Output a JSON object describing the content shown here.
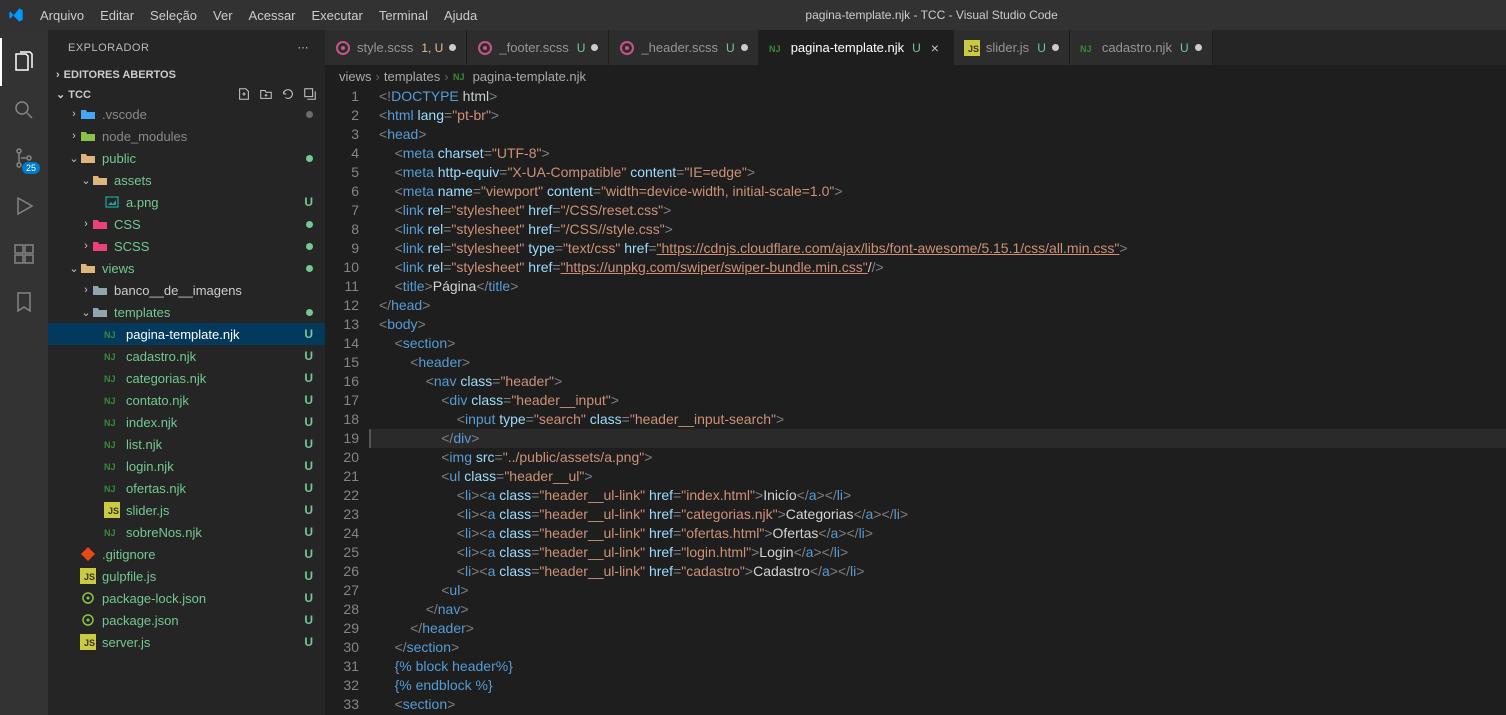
{
  "window": {
    "title": "pagina-template.njk - TCC - Visual Studio Code"
  },
  "menu": [
    "Arquivo",
    "Editar",
    "Seleção",
    "Ver",
    "Acessar",
    "Executar",
    "Terminal",
    "Ajuda"
  ],
  "activitybar": {
    "scm_badge": "25"
  },
  "sidebar": {
    "title": "EXPLORADOR",
    "section_open_editors": "EDITORES ABERTOS",
    "root": "TCC",
    "tree": [
      {
        "indent": 1,
        "chev": "›",
        "icon": "folder-blue",
        "label": ".vscode",
        "color": "#8a8a8a",
        "dot": "#6c6c6c"
      },
      {
        "indent": 1,
        "chev": "›",
        "icon": "folder-green",
        "label": "node_modules",
        "color": "#8a8a8a"
      },
      {
        "indent": 1,
        "chev": "⌄",
        "icon": "folder-yellow",
        "label": "public",
        "color": "#73c991",
        "dot": "#73c991"
      },
      {
        "indent": 2,
        "chev": "⌄",
        "icon": "folder-yellow",
        "label": "assets",
        "color": "#73c991"
      },
      {
        "indent": 3,
        "chev": "",
        "icon": "img",
        "label": "a.png",
        "color": "#73c991",
        "status": "U"
      },
      {
        "indent": 2,
        "chev": "›",
        "icon": "folder-pink",
        "label": "CSS",
        "color": "#73c991",
        "dot": "#73c991"
      },
      {
        "indent": 2,
        "chev": "›",
        "icon": "folder-pink",
        "label": "SCSS",
        "color": "#73c991",
        "dot": "#73c991"
      },
      {
        "indent": 1,
        "chev": "⌄",
        "icon": "folder-yellow",
        "label": "views",
        "color": "#73c991",
        "dot": "#73c991"
      },
      {
        "indent": 2,
        "chev": "›",
        "icon": "folder-grey",
        "label": "banco__de__imagens",
        "color": "#cccccc"
      },
      {
        "indent": 2,
        "chev": "⌄",
        "icon": "folder-grey",
        "label": "templates",
        "color": "#73c991",
        "dot": "#73c991"
      },
      {
        "indent": 3,
        "chev": "",
        "icon": "njk",
        "label": "pagina-template.njk",
        "color": "#ffffff",
        "status": "U",
        "selected": true
      },
      {
        "indent": 3,
        "chev": "",
        "icon": "njk",
        "label": "cadastro.njk",
        "color": "#73c991",
        "status": "U"
      },
      {
        "indent": 3,
        "chev": "",
        "icon": "njk",
        "label": "categorias.njk",
        "color": "#73c991",
        "status": "U"
      },
      {
        "indent": 3,
        "chev": "",
        "icon": "njk",
        "label": "contato.njk",
        "color": "#73c991",
        "status": "U"
      },
      {
        "indent": 3,
        "chev": "",
        "icon": "njk",
        "label": "index.njk",
        "color": "#73c991",
        "status": "U"
      },
      {
        "indent": 3,
        "chev": "",
        "icon": "njk",
        "label": "list.njk",
        "color": "#73c991",
        "status": "U"
      },
      {
        "indent": 3,
        "chev": "",
        "icon": "njk",
        "label": "login.njk",
        "color": "#73c991",
        "status": "U"
      },
      {
        "indent": 3,
        "chev": "",
        "icon": "njk",
        "label": "ofertas.njk",
        "color": "#73c991",
        "status": "U"
      },
      {
        "indent": 3,
        "chev": "",
        "icon": "js",
        "label": "slider.js",
        "color": "#73c991",
        "status": "U"
      },
      {
        "indent": 3,
        "chev": "",
        "icon": "njk",
        "label": "sobreNos.njk",
        "color": "#73c991",
        "status": "U"
      },
      {
        "indent": 1,
        "chev": "",
        "icon": "git",
        "label": ".gitignore",
        "color": "#73c991",
        "status": "U"
      },
      {
        "indent": 1,
        "chev": "",
        "icon": "js",
        "label": "gulpfile.js",
        "color": "#73c991",
        "status": "U"
      },
      {
        "indent": 1,
        "chev": "",
        "icon": "npm",
        "label": "package-lock.json",
        "color": "#73c991",
        "status": "U"
      },
      {
        "indent": 1,
        "chev": "",
        "icon": "npm",
        "label": "package.json",
        "color": "#73c991",
        "status": "U"
      },
      {
        "indent": 1,
        "chev": "",
        "icon": "js",
        "label": "server.js",
        "color": "#73c991",
        "status": "U"
      }
    ]
  },
  "tabs": [
    {
      "icon": "scss",
      "label": "style.scss",
      "status": "1, U",
      "scolor": "#e2c08d",
      "dot": true
    },
    {
      "icon": "scss",
      "label": "_footer.scss",
      "status": "U",
      "scolor": "#73c991",
      "dot": true
    },
    {
      "icon": "scss",
      "label": "_header.scss",
      "status": "U",
      "scolor": "#73c991",
      "dot": true
    },
    {
      "icon": "njk",
      "label": "pagina-template.njk",
      "status": "U",
      "scolor": "#73c991",
      "active": true,
      "close": true
    },
    {
      "icon": "js",
      "label": "slider.js",
      "status": "U",
      "scolor": "#73c991",
      "dot": true
    },
    {
      "icon": "njk",
      "label": "cadastro.njk",
      "status": "U",
      "scolor": "#73c991",
      "dot": true
    }
  ],
  "breadcrumb": {
    "p1": "views",
    "p2": "templates",
    "p3": "pagina-template.njk"
  },
  "code_lines": [
    "<!DOCTYPE html>",
    "<html lang=\"pt-br\">",
    "<head>",
    "    <meta charset=\"UTF-8\">",
    "    <meta http-equiv=\"X-UA-Compatible\" content=\"IE=edge\">",
    "    <meta name=\"viewport\" content=\"width=device-width, initial-scale=1.0\">",
    "    <link rel=\"stylesheet\" href=\"/CSS/reset.css\">",
    "    <link rel=\"stylesheet\" href=\"/CSS//style.css\">",
    "    <link rel=\"stylesheet\" type=\"text/css\" href=\"https://cdnjs.cloudflare.com/ajax/libs/font-awesome/5.15.1/css/all.min.css\">",
    "    <link rel=\"stylesheet\" href=\"https://unpkg.com/swiper/swiper-bundle.min.css\"/>",
    "    <title>Página</title>",
    "</head>",
    "<body>",
    "    <section>",
    "        <header>",
    "            <nav class=\"header\">",
    "                <div class=\"header__input\">",
    "                    <input type=\"search\" class=\"header__input-search\">",
    "                </div>",
    "                <img src=\"../public/assets/a.png\">",
    "                <ul class=\"header__ul\">",
    "                    <li><a class=\"header__ul-link\" href=\"index.html\">Inicío</a></li>",
    "                    <li><a class=\"header__ul-link\" href=\"categorias.njk\">Categorias</a></li>",
    "                    <li><a class=\"header__ul-link\" href=\"ofertas.html\">Ofertas</a></li>",
    "                    <li><a class=\"header__ul-link\" href=\"login.html\">Login</a></li>",
    "                    <li><a class=\"header__ul-link\" href=\"cadastro\">Cadastro</a></li>",
    "                <ul>",
    "            </nav>",
    "        </header>",
    "    </section>",
    "    {% block header%}",
    "    {% endblock %}",
    "    <section>"
  ],
  "highlight_line": 19
}
